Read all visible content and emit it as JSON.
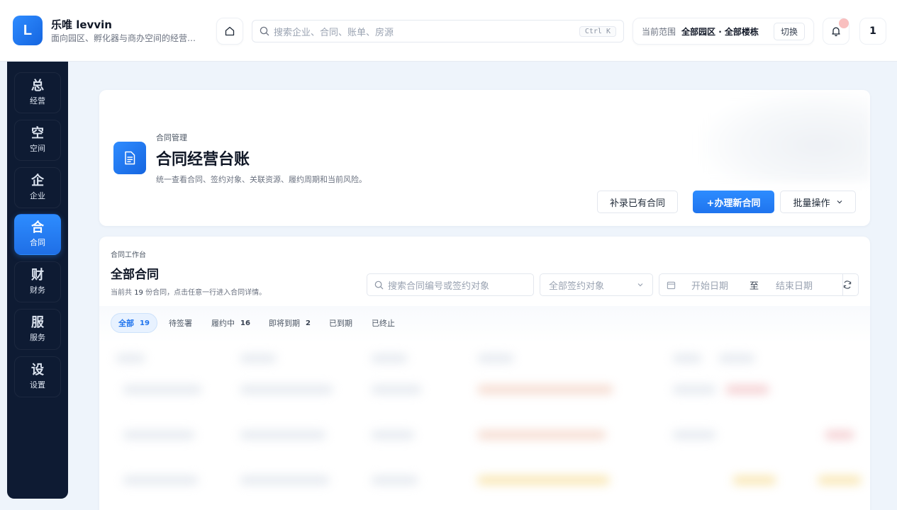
{
  "app": {
    "logo_letter": "L",
    "name": "乐唯 levvin",
    "subtitle": "面向园区、孵化器与商办空间的经营…"
  },
  "header": {
    "search_placeholder": "搜索企业、合同、账单、房源",
    "search_shortcut": "Ctrl K",
    "scope_label": "当前范围",
    "scope_value": "全部园区 · 全部楼栋",
    "scope_switch": "切换",
    "user_initial": "1"
  },
  "sidebar": {
    "items": [
      {
        "icon": "总",
        "label": "经营",
        "active": false
      },
      {
        "icon": "空",
        "label": "空间",
        "active": false
      },
      {
        "icon": "企",
        "label": "企业",
        "active": false
      },
      {
        "icon": "合",
        "label": "合同",
        "active": true
      },
      {
        "icon": "财",
        "label": "财务",
        "active": false
      },
      {
        "icon": "服",
        "label": "服务",
        "active": false
      },
      {
        "icon": "设",
        "label": "设置",
        "active": false
      }
    ]
  },
  "page": {
    "kicker": "合同管理",
    "title": "合同经营台账",
    "description": "统一查看合同、签约对象、关联资源、履约周期和当前风险。",
    "btn_add_existing": "补录已有合同",
    "btn_new": "+办理新合同",
    "btn_batch": "批量操作"
  },
  "workspace": {
    "kicker": "合同工作台",
    "title": "全部合同",
    "desc_prefix": "当前共",
    "desc_count": "19",
    "desc_suffix": "份合同，点击任意一行进入合同详情。",
    "search_placeholder": "搜索合同编号或签约对象",
    "party_select": "全部签约对象",
    "date_start": "开始日期",
    "date_sep": "至",
    "date_end": "结束日期",
    "tabs": [
      {
        "label": "全部",
        "count": "19",
        "active": true
      },
      {
        "label": "待签署",
        "count": "",
        "active": false
      },
      {
        "label": "履约中",
        "count": "16",
        "active": false
      },
      {
        "label": "即将到期",
        "count": "2",
        "active": false
      },
      {
        "label": "已到期",
        "count": "",
        "active": false
      },
      {
        "label": "已终止",
        "count": "",
        "active": false
      }
    ]
  },
  "colors": {
    "primary": "#1f74ee",
    "sidebar_bg": "#0e1b33",
    "page_bg": "#eef4fb"
  }
}
